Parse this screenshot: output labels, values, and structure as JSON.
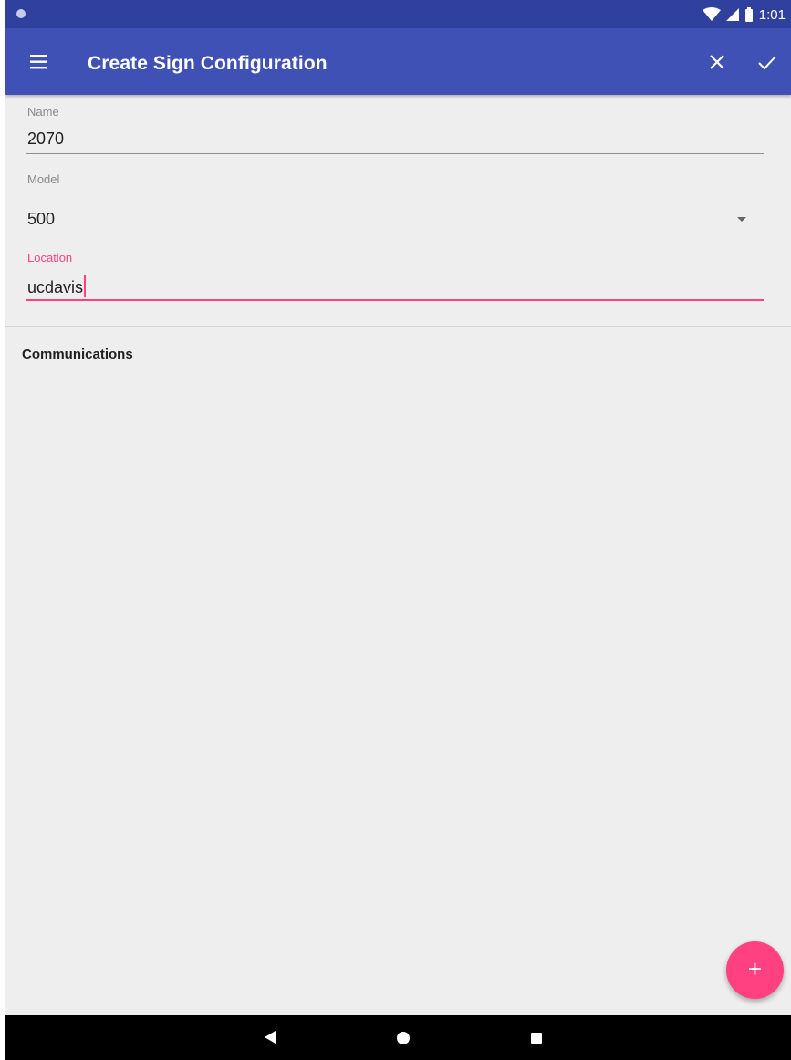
{
  "status_bar": {
    "time": "1:01",
    "icons": [
      "notification-dot-icon",
      "wifi-icon",
      "cell-signal-icon",
      "battery-icon"
    ]
  },
  "app_bar": {
    "title": "Create Sign Configuration",
    "icons": [
      "menu-icon",
      "close-icon",
      "check-icon"
    ],
    "color": "#3f51b5"
  },
  "form": {
    "name": {
      "label": "Name",
      "value": "2070"
    },
    "model": {
      "label": "Model",
      "value": "500",
      "icon": "dropdown-arrow-icon"
    },
    "location": {
      "label": "Location",
      "value": "ucdavis",
      "focused": true,
      "accent": "#ff4081"
    }
  },
  "sections": {
    "communications": {
      "title": "Communications"
    }
  },
  "fab": {
    "icon": "plus-icon",
    "color": "#ff4081"
  },
  "nav_bar": {
    "icons": [
      "back-icon",
      "home-icon",
      "recents-icon"
    ]
  }
}
